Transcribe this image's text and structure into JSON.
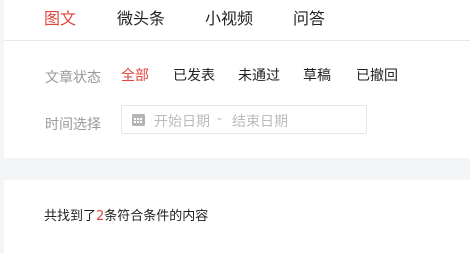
{
  "tabs": [
    {
      "label": "图文",
      "active": true
    },
    {
      "label": "微头条",
      "active": false
    },
    {
      "label": "小视频",
      "active": false
    },
    {
      "label": "问答",
      "active": false
    }
  ],
  "filters": {
    "status_label": "文章状态",
    "options": [
      {
        "label": "全部",
        "active": true
      },
      {
        "label": "已发表",
        "active": false
      },
      {
        "label": "未通过",
        "active": false
      },
      {
        "label": "草稿",
        "active": false
      },
      {
        "label": "已撤回",
        "active": false
      }
    ],
    "time_label": "时间选择",
    "start_placeholder": "开始日期",
    "separator": "-",
    "end_placeholder": "结束日期"
  },
  "results": {
    "prefix": "共找到了",
    "count": "2",
    "suffix": "条符合条件的内容"
  },
  "colors": {
    "accent": "#e0453d",
    "background": "#f4f5f6",
    "muted_text": "#999999"
  }
}
